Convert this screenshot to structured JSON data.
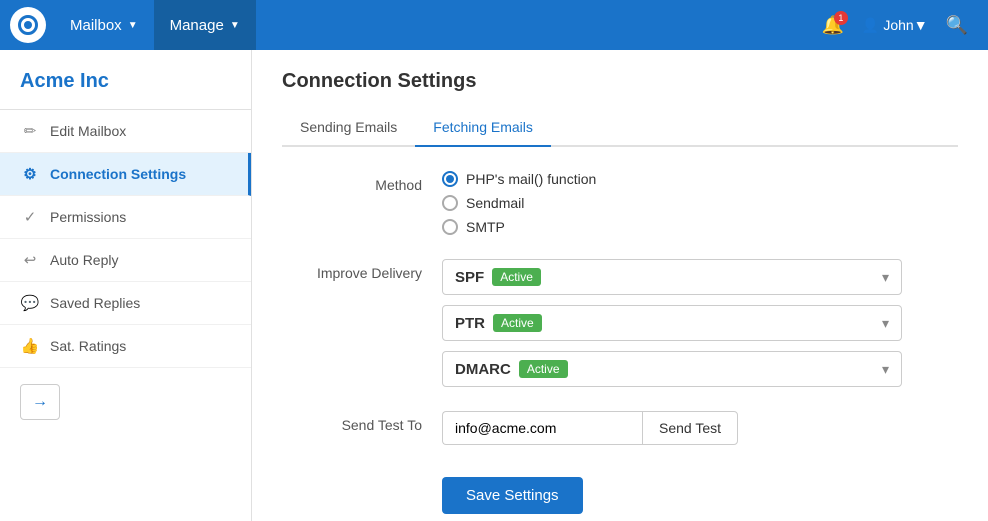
{
  "topNav": {
    "logo_alt": "Logo",
    "items": [
      {
        "label": "Mailbox",
        "caret": "▼",
        "active": false
      },
      {
        "label": "Manage",
        "caret": "▼",
        "active": true
      }
    ],
    "notification_count": "1",
    "user_name": "John",
    "user_caret": "▼"
  },
  "sidebar": {
    "company_name": "Acme Inc",
    "items": [
      {
        "label": "Edit Mailbox",
        "icon": "✏"
      },
      {
        "label": "Connection Settings",
        "icon": "⚙",
        "active": true
      },
      {
        "label": "Permissions",
        "icon": "✓"
      },
      {
        "label": "Auto Reply",
        "icon": "↩"
      },
      {
        "label": "Saved Replies",
        "icon": "💬"
      },
      {
        "label": "Sat. Ratings",
        "icon": "👍"
      }
    ],
    "arrow_icon": "→"
  },
  "main": {
    "page_title": "Connection Settings",
    "tabs": [
      {
        "label": "Sending Emails",
        "active": false
      },
      {
        "label": "Fetching Emails",
        "active": true
      }
    ],
    "form": {
      "method_label": "Method",
      "method_options": [
        {
          "label": "PHP's mail() function",
          "selected": true
        },
        {
          "label": "Sendmail",
          "selected": false
        },
        {
          "label": "SMTP",
          "selected": false
        }
      ],
      "improve_delivery_label": "Improve Delivery",
      "delivery_options": [
        {
          "label": "SPF",
          "status": "Active"
        },
        {
          "label": "PTR",
          "status": "Active"
        },
        {
          "label": "DMARC",
          "status": "Active"
        }
      ],
      "send_test_label": "Send Test To",
      "send_test_placeholder": "info@acme.com",
      "send_test_button": "Send Test",
      "save_button": "Save Settings"
    }
  }
}
